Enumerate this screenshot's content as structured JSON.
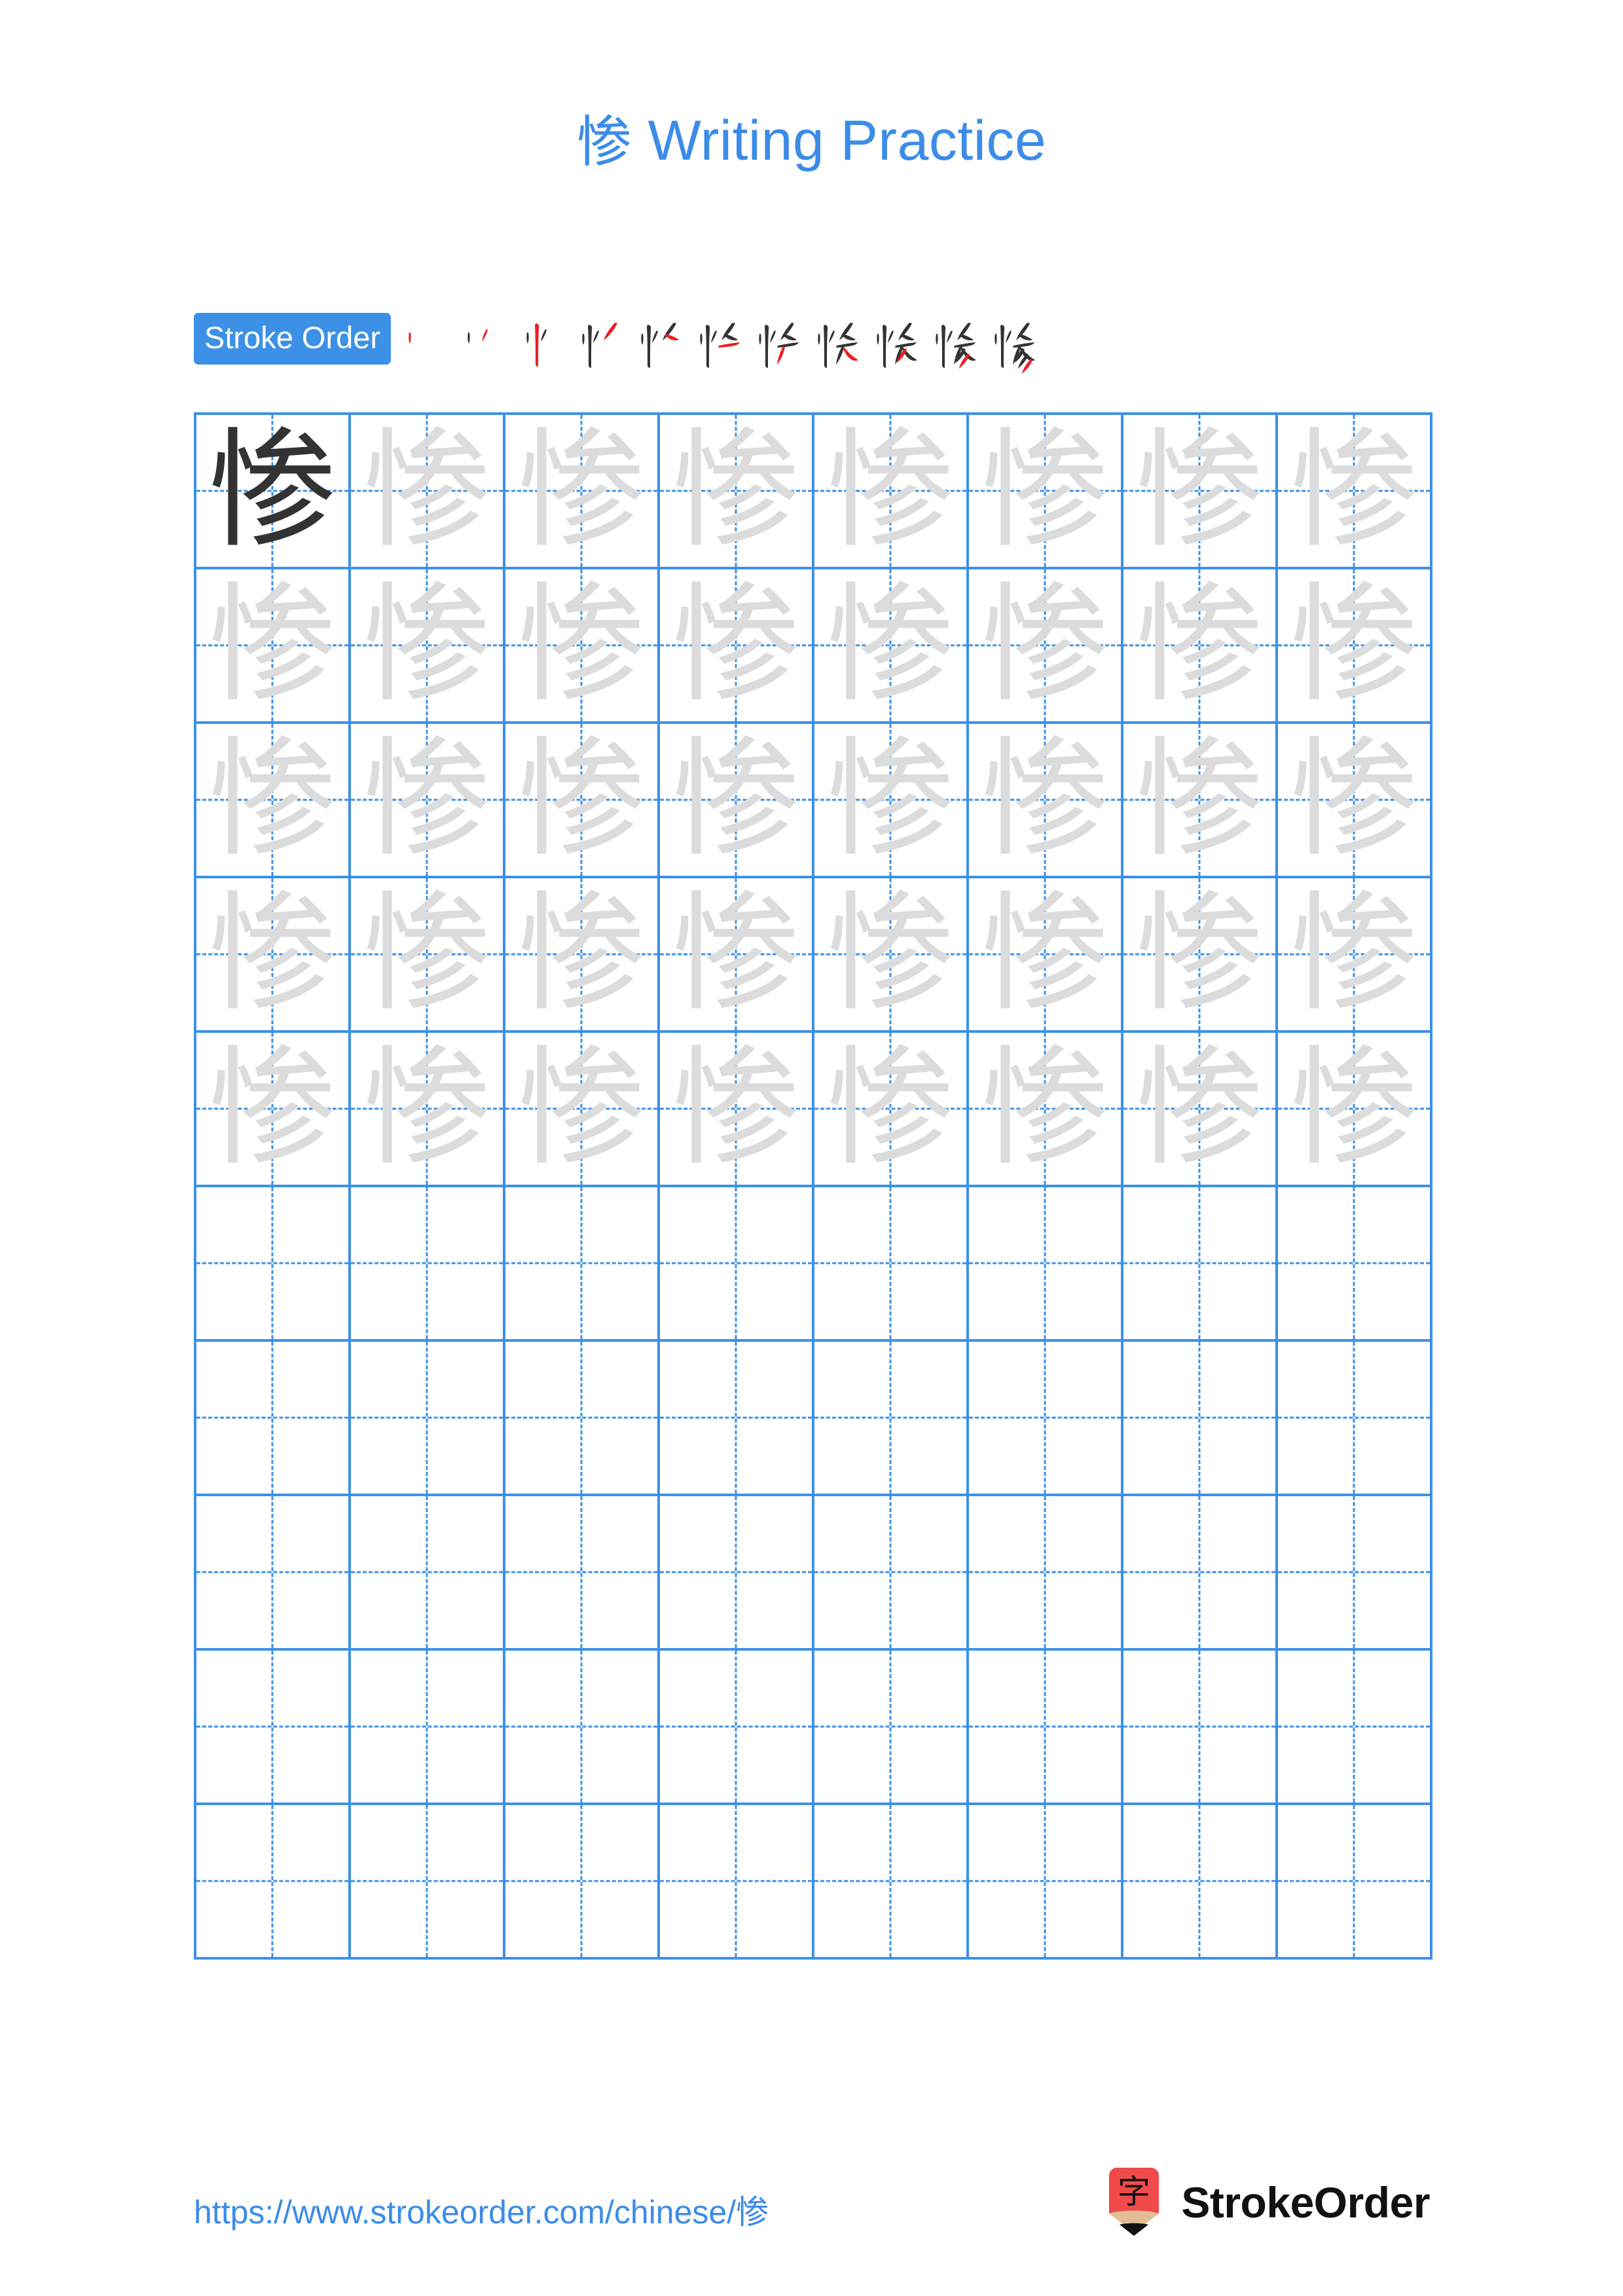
{
  "page": {
    "character": "惨",
    "title": "惨 Writing Practice",
    "title_prefix_char": "惨",
    "title_suffix": " Writing Practice",
    "background_color": "#ffffff"
  },
  "stroke_order": {
    "badge_label": "Stroke Order",
    "badge_bg_color": "#3c91e6",
    "badge_text_color": "#ffffff",
    "total_strokes": 11,
    "existing_stroke_color": "#333333",
    "new_stroke_color": "#ee1c23",
    "steps": [
      {
        "index": 1,
        "strokes_shown": 1,
        "glyph": "丶"
      },
      {
        "index": 2,
        "strokes_shown": 2,
        "glyph": "丷"
      },
      {
        "index": 3,
        "strokes_shown": 3,
        "glyph": "忄"
      },
      {
        "index": 4,
        "strokes_shown": 4,
        "glyph": "忄丿"
      },
      {
        "index": 5,
        "strokes_shown": 5,
        "glyph": "忄厶"
      },
      {
        "index": 6,
        "strokes_shown": 6,
        "glyph": "忄厶一"
      },
      {
        "index": 7,
        "strokes_shown": 7,
        "glyph": "忄夂"
      },
      {
        "index": 8,
        "strokes_shown": 8,
        "glyph": "忄夂丿"
      },
      {
        "index": 9,
        "strokes_shown": 9,
        "glyph": "忄夂彡"
      },
      {
        "index": 10,
        "strokes_shown": 10,
        "glyph": "惨"
      },
      {
        "index": 11,
        "strokes_shown": 11,
        "glyph": "惨"
      }
    ]
  },
  "grid": {
    "columns": 8,
    "rows": 10,
    "line_color": "#3c91e6",
    "model_char_color": "#333333",
    "trace_char_color": "#dcdcdc",
    "filled_rows": 5,
    "cells": [
      [
        {
          "char": "惨",
          "style": "model"
        },
        {
          "char": "惨",
          "style": "trace"
        },
        {
          "char": "惨",
          "style": "trace"
        },
        {
          "char": "惨",
          "style": "trace"
        },
        {
          "char": "惨",
          "style": "trace"
        },
        {
          "char": "惨",
          "style": "trace"
        },
        {
          "char": "惨",
          "style": "trace"
        },
        {
          "char": "惨",
          "style": "trace"
        }
      ],
      [
        {
          "char": "惨",
          "style": "trace"
        },
        {
          "char": "惨",
          "style": "trace"
        },
        {
          "char": "惨",
          "style": "trace"
        },
        {
          "char": "惨",
          "style": "trace"
        },
        {
          "char": "惨",
          "style": "trace"
        },
        {
          "char": "惨",
          "style": "trace"
        },
        {
          "char": "惨",
          "style": "trace"
        },
        {
          "char": "惨",
          "style": "trace"
        }
      ],
      [
        {
          "char": "惨",
          "style": "trace"
        },
        {
          "char": "惨",
          "style": "trace"
        },
        {
          "char": "惨",
          "style": "trace"
        },
        {
          "char": "惨",
          "style": "trace"
        },
        {
          "char": "惨",
          "style": "trace"
        },
        {
          "char": "惨",
          "style": "trace"
        },
        {
          "char": "惨",
          "style": "trace"
        },
        {
          "char": "惨",
          "style": "trace"
        }
      ],
      [
        {
          "char": "惨",
          "style": "trace"
        },
        {
          "char": "惨",
          "style": "trace"
        },
        {
          "char": "惨",
          "style": "trace"
        },
        {
          "char": "惨",
          "style": "trace"
        },
        {
          "char": "惨",
          "style": "trace"
        },
        {
          "char": "惨",
          "style": "trace"
        },
        {
          "char": "惨",
          "style": "trace"
        },
        {
          "char": "惨",
          "style": "trace"
        }
      ],
      [
        {
          "char": "惨",
          "style": "trace"
        },
        {
          "char": "惨",
          "style": "trace"
        },
        {
          "char": "惨",
          "style": "trace"
        },
        {
          "char": "惨",
          "style": "trace"
        },
        {
          "char": "惨",
          "style": "trace"
        },
        {
          "char": "惨",
          "style": "trace"
        },
        {
          "char": "惨",
          "style": "trace"
        },
        {
          "char": "惨",
          "style": "trace"
        }
      ],
      [
        {
          "char": "",
          "style": "empty"
        },
        {
          "char": "",
          "style": "empty"
        },
        {
          "char": "",
          "style": "empty"
        },
        {
          "char": "",
          "style": "empty"
        },
        {
          "char": "",
          "style": "empty"
        },
        {
          "char": "",
          "style": "empty"
        },
        {
          "char": "",
          "style": "empty"
        },
        {
          "char": "",
          "style": "empty"
        }
      ],
      [
        {
          "char": "",
          "style": "empty"
        },
        {
          "char": "",
          "style": "empty"
        },
        {
          "char": "",
          "style": "empty"
        },
        {
          "char": "",
          "style": "empty"
        },
        {
          "char": "",
          "style": "empty"
        },
        {
          "char": "",
          "style": "empty"
        },
        {
          "char": "",
          "style": "empty"
        },
        {
          "char": "",
          "style": "empty"
        }
      ],
      [
        {
          "char": "",
          "style": "empty"
        },
        {
          "char": "",
          "style": "empty"
        },
        {
          "char": "",
          "style": "empty"
        },
        {
          "char": "",
          "style": "empty"
        },
        {
          "char": "",
          "style": "empty"
        },
        {
          "char": "",
          "style": "empty"
        },
        {
          "char": "",
          "style": "empty"
        },
        {
          "char": "",
          "style": "empty"
        }
      ],
      [
        {
          "char": "",
          "style": "empty"
        },
        {
          "char": "",
          "style": "empty"
        },
        {
          "char": "",
          "style": "empty"
        },
        {
          "char": "",
          "style": "empty"
        },
        {
          "char": "",
          "style": "empty"
        },
        {
          "char": "",
          "style": "empty"
        },
        {
          "char": "",
          "style": "empty"
        },
        {
          "char": "",
          "style": "empty"
        }
      ],
      [
        {
          "char": "",
          "style": "empty"
        },
        {
          "char": "",
          "style": "empty"
        },
        {
          "char": "",
          "style": "empty"
        },
        {
          "char": "",
          "style": "empty"
        },
        {
          "char": "",
          "style": "empty"
        },
        {
          "char": "",
          "style": "empty"
        },
        {
          "char": "",
          "style": "empty"
        },
        {
          "char": "",
          "style": "empty"
        }
      ]
    ]
  },
  "footer": {
    "url": "https://www.strokeorder.com/chinese/惨",
    "url_color": "#3c8ce8",
    "brand_name": "StrokeOrder",
    "brand_color": "#111111",
    "logo": {
      "icon_name": "pencil-logo-icon",
      "body_color": "#f04a4a",
      "wood_color": "#e3bd96",
      "tip_color": "#111111",
      "glyph": "字"
    }
  }
}
